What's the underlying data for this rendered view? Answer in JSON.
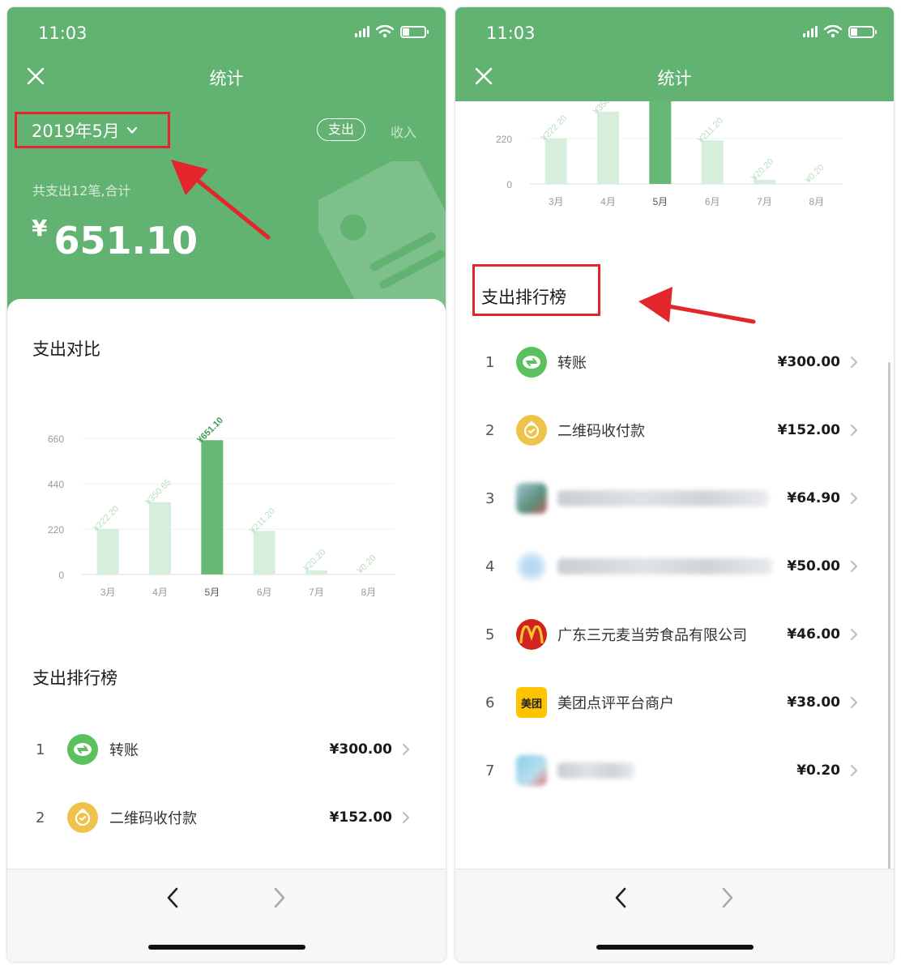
{
  "status": {
    "time": "11:03"
  },
  "header": {
    "title": "统计"
  },
  "filter": {
    "month": "2019年5月",
    "expense_label": "支出",
    "income_label": "收入"
  },
  "summary": {
    "label": "共支出12笔,合计",
    "currency": "¥",
    "amount": "651.10"
  },
  "comparison": {
    "title": "支出对比"
  },
  "chart_data": {
    "type": "bar",
    "categories": [
      "3月",
      "4月",
      "5月",
      "6月",
      "7月",
      "8月"
    ],
    "values": [
      222.2,
      350.65,
      651.1,
      211.2,
      20.2,
      0.2
    ],
    "data_labels": [
      "¥222.20",
      "¥350.65",
      "¥651.10",
      "¥211.20",
      "¥20.20",
      "¥0.20"
    ],
    "highlight_index": 2,
    "yticks": [
      0,
      220,
      440,
      660
    ],
    "ylim": [
      0,
      660
    ],
    "grid": true,
    "colors": {
      "bar": "#d6eedb",
      "highlight": "#67b775",
      "label": "#b7dfbf",
      "highlight_label": "#3f9a52"
    }
  },
  "ranking": {
    "title": "支出排行榜",
    "items": [
      {
        "rank": "1",
        "name": "转账",
        "amount": "¥300.00",
        "icon": "transfer-icon"
      },
      {
        "rank": "2",
        "name": "二维码收付款",
        "amount": "¥152.00",
        "icon": "qr-payment-icon"
      },
      {
        "rank": "3",
        "name": "",
        "amount": "¥64.90",
        "icon": "blurred-merchant-icon"
      },
      {
        "rank": "4",
        "name": "",
        "amount": "¥50.00",
        "icon": "blurred-merchant-icon"
      },
      {
        "rank": "5",
        "name": "广东三元麦当劳食品有限公司",
        "amount": "¥46.00",
        "icon": "mcdonalds-icon"
      },
      {
        "rank": "6",
        "name": "美团点评平台商户",
        "amount": "¥38.00",
        "icon": "meituan-icon",
        "icon_text": "美团"
      },
      {
        "rank": "7",
        "name": "",
        "amount": "¥0.20",
        "icon": "blurred-merchant-icon"
      }
    ]
  },
  "colors": {
    "brand_green": "#62b271",
    "annotation_red": "#e3262c"
  }
}
